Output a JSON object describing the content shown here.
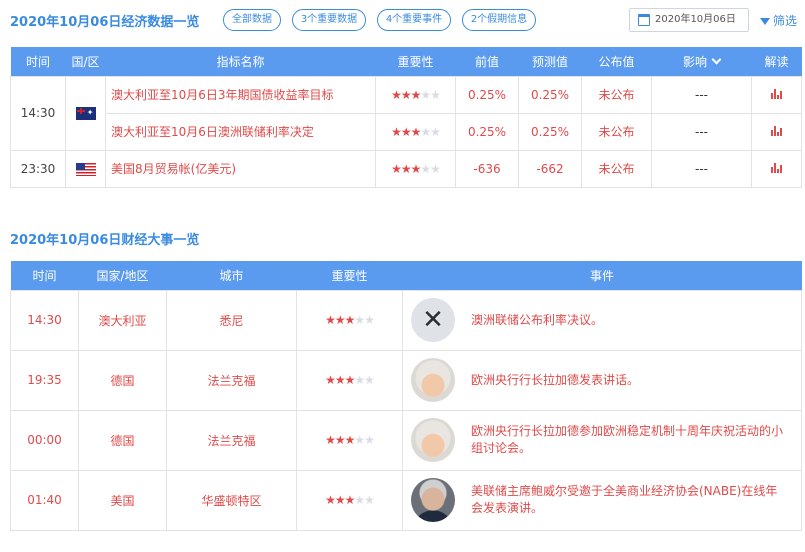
{
  "section1": {
    "title": "2020年10月06日经济数据一览"
  },
  "tabs": [
    {
      "label": "全部数据"
    },
    {
      "label": "3个重要数据"
    },
    {
      "label": "4个重要事件"
    },
    {
      "label": "2个假期信息"
    }
  ],
  "date_picker": {
    "value": "2020年10月06日",
    "icon": "calendar-icon"
  },
  "filter": {
    "label": "筛选",
    "icon": "filter-icon"
  },
  "colors": {
    "accent": "#3a8be0",
    "header_bg": "#5b9bef",
    "highlight": "#e04a4a"
  },
  "data_table": {
    "headers": [
      "时间",
      "国/区",
      "指标名称",
      "重要性",
      "前值",
      "预测值",
      "公布值",
      "影响",
      "解读"
    ],
    "groups": [
      {
        "time": "14:30",
        "flag": "australia-flag-icon",
        "rows": [
          {
            "name": "澳大利亚至10月6日3年期国债收益率目标",
            "importance": 3,
            "prev": "0.25%",
            "forecast": "0.25%",
            "actual": "未公布",
            "impact": "---"
          },
          {
            "name": "澳大利亚至10月6日澳洲联储利率决定",
            "importance": 3,
            "prev": "0.25%",
            "forecast": "0.25%",
            "actual": "未公布",
            "impact": "---"
          }
        ]
      },
      {
        "time": "23:30",
        "flag": "usa-flag-icon",
        "rows": [
          {
            "name": "美国8月贸易帐(亿美元)",
            "importance": 3,
            "prev": "-636",
            "forecast": "-662",
            "actual": "未公布",
            "impact": "---"
          }
        ]
      }
    ]
  },
  "section2": {
    "title": "2020年10月06日财经大事一览"
  },
  "events_table": {
    "headers": [
      "时间",
      "国家/地区",
      "城市",
      "重要性",
      "事件"
    ],
    "rows": [
      {
        "time": "14:30",
        "country": "澳大利亚",
        "city": "悉尼",
        "importance": 3,
        "avatar": "rba-logo-icon",
        "event": "澳洲联储公布利率决议。"
      },
      {
        "time": "19:35",
        "country": "德国",
        "city": "法兰克福",
        "importance": 3,
        "avatar": "lagarde-avatar",
        "event": "欧洲央行行长拉加德发表讲话。"
      },
      {
        "time": "00:00",
        "country": "德国",
        "city": "法兰克福",
        "importance": 3,
        "avatar": "lagarde-avatar",
        "event": "欧洲央行行长拉加德参加欧洲稳定机制十周年庆祝活动的小组讨论会。"
      },
      {
        "time": "01:40",
        "country": "美国",
        "city": "华盛顿特区",
        "importance": 3,
        "avatar": "powell-avatar",
        "event": "美联储主席鲍威尔受邀于全美商业经济协会(NABE)在线年会发表演讲。"
      }
    ]
  }
}
